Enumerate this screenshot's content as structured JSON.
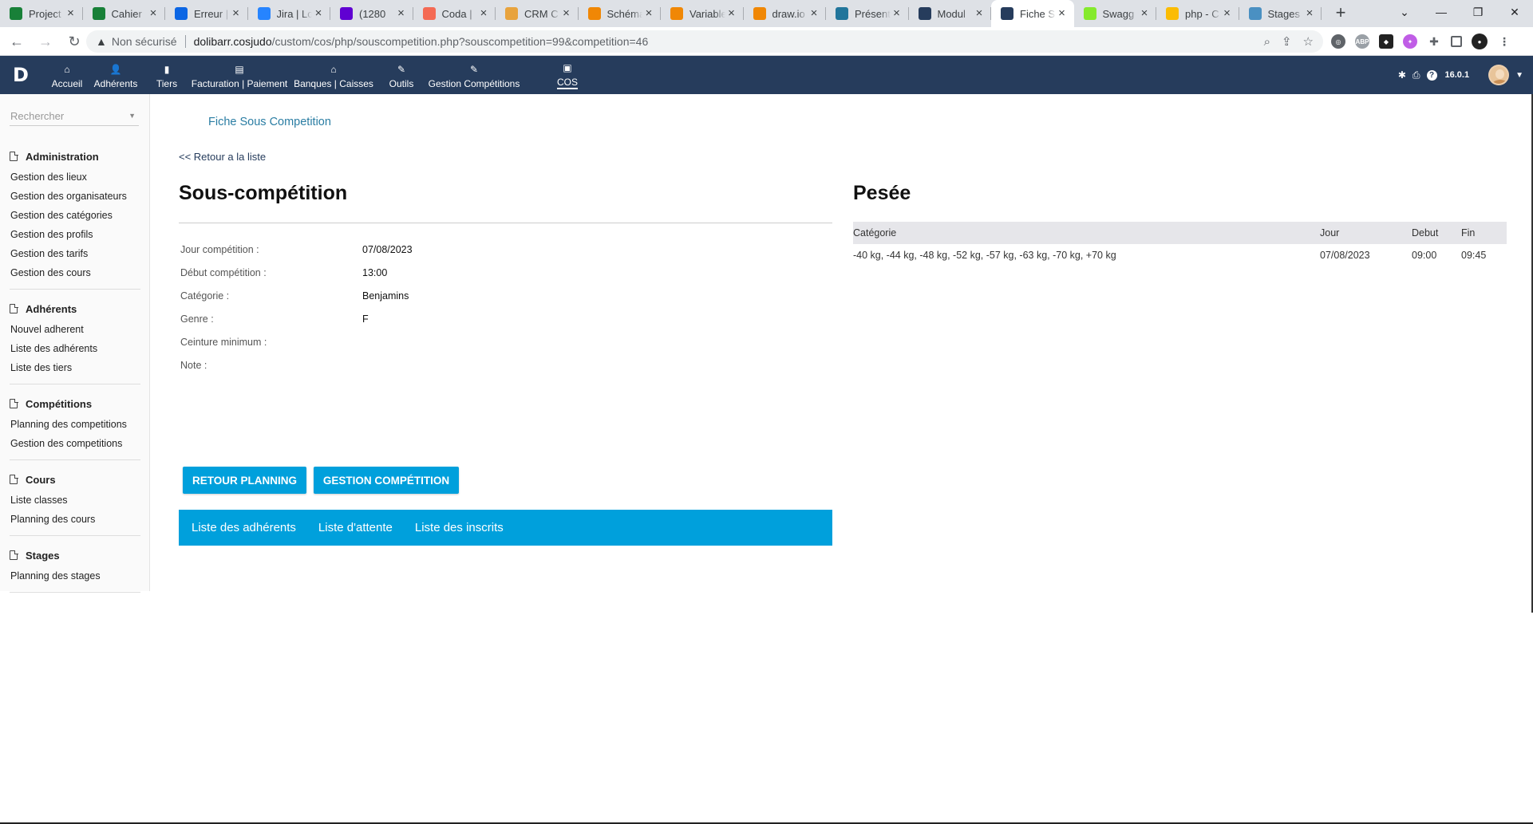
{
  "browser": {
    "tabs": [
      {
        "title": "Project",
        "icon": "sheets-icon",
        "color": "#188038",
        "active": false
      },
      {
        "title": "Cahier",
        "icon": "sheets-icon",
        "color": "#188038",
        "active": false
      },
      {
        "title": "Erreur |",
        "icon": "trello-icon",
        "color": "#0c66e4",
        "active": false
      },
      {
        "title": "Jira | Lo",
        "icon": "jira-icon",
        "color": "#2684ff",
        "active": false
      },
      {
        "title": "(1280",
        "icon": "mail-icon",
        "color": "#6001d2",
        "active": false
      },
      {
        "title": "Coda |",
        "icon": "coda-icon",
        "color": "#f46a54",
        "active": false
      },
      {
        "title": "CRM C",
        "icon": "crm-icon",
        "color": "#e8a33d",
        "active": false
      },
      {
        "title": "Schéma",
        "icon": "drawio-icon",
        "color": "#f08705",
        "active": false
      },
      {
        "title": "Variable",
        "icon": "drawio-icon",
        "color": "#f08705",
        "active": false
      },
      {
        "title": "draw.io",
        "icon": "drawio-icon",
        "color": "#f08705",
        "active": false
      },
      {
        "title": "Présent",
        "icon": "wordpress-icon",
        "color": "#21759b",
        "active": false
      },
      {
        "title": "Modul",
        "icon": "dolibarr-icon",
        "color": "#263c5c",
        "active": false
      },
      {
        "title": "Fiche S",
        "icon": "dolibarr-icon",
        "color": "#263c5c",
        "active": true
      },
      {
        "title": "Swagg",
        "icon": "swagger-icon",
        "color": "#85ea2d",
        "active": false
      },
      {
        "title": "php - C",
        "icon": "drive-icon",
        "color": "#fbbc04",
        "active": false
      },
      {
        "title": "Stages",
        "icon": "stages-icon",
        "color": "#4a90c2",
        "active": false
      }
    ],
    "address": {
      "insecure_label": "Non sécurisé",
      "host": "dolibarr.cosjudo",
      "path": "/custom/cos/php/souscompetition.php?souscompetition=99&competition=46"
    }
  },
  "topmenu": {
    "items": [
      {
        "label": "Accueil",
        "icon": "home-icon",
        "glyph": "⌂"
      },
      {
        "label": "Adhérents",
        "icon": "user-icon",
        "glyph": "👤"
      },
      {
        "label": "Tiers",
        "icon": "building-icon",
        "glyph": "▮"
      },
      {
        "label": "Facturation | Paiement",
        "icon": "money-icon",
        "glyph": "▤"
      },
      {
        "label": "Banques | Caisses",
        "icon": "bank-icon",
        "glyph": "⌂"
      },
      {
        "label": "Outils",
        "icon": "wrench-icon",
        "glyph": "✎"
      },
      {
        "label": "Gestion Compétitions",
        "icon": "edit-icon",
        "glyph": "✎"
      },
      {
        "label": "COS",
        "icon": "module-icon",
        "glyph": "▣"
      }
    ],
    "version": "16.0.1"
  },
  "sidebar": {
    "search_placeholder": "Rechercher",
    "blocks": [
      {
        "title": "Administration",
        "links": [
          "Gestion des lieux",
          "Gestion des organisateurs",
          "Gestion des catégories",
          "Gestion des profils",
          "Gestion des tarifs",
          "Gestion des cours"
        ]
      },
      {
        "title": "Adhérents",
        "links": [
          "Nouvel adherent",
          "Liste des adhérents",
          "Liste des tiers"
        ]
      },
      {
        "title": "Compétitions",
        "links": [
          "Planning des competitions",
          "Gestion des competitions"
        ]
      },
      {
        "title": "Cours",
        "links": [
          "Liste classes",
          "Planning des cours"
        ]
      },
      {
        "title": "Stages",
        "links": [
          "Planning des stages"
        ]
      }
    ]
  },
  "main": {
    "fiche_tab": "Fiche Sous Competition",
    "back_link": "<< Retour a la liste",
    "left_title": "Sous-compétition",
    "fields": [
      {
        "label": "Jour compétition :",
        "value": "07/08/2023"
      },
      {
        "label": "Début compétition :",
        "value": "13:00"
      },
      {
        "label": "Catégorie :",
        "value": "Benjamins"
      },
      {
        "label": "Genre :",
        "value": "F"
      },
      {
        "label": "Ceinture minimum :",
        "value": ""
      },
      {
        "label": "Note :",
        "value": ""
      }
    ],
    "buttons": {
      "retour": "RETOUR PLANNING",
      "gestion": "GESTION COMPÉTITION"
    },
    "subtabs": [
      "Liste des adhérents",
      "Liste d'attente",
      "Liste des inscrits"
    ],
    "right_title": "Pesée",
    "pesee": {
      "headers": [
        "Catégorie",
        "Jour",
        "Debut",
        "Fin"
      ],
      "rows": [
        [
          "-40 kg, -44 kg, -48 kg, -52 kg, -57 kg, -63 kg, -70 kg, +70 kg",
          "07/08/2023",
          "09:00",
          "09:45"
        ]
      ]
    }
  },
  "colors": {
    "topmenu_bg": "#263c5c",
    "button_bg": "#00a0dc",
    "link": "#2a7da3"
  }
}
